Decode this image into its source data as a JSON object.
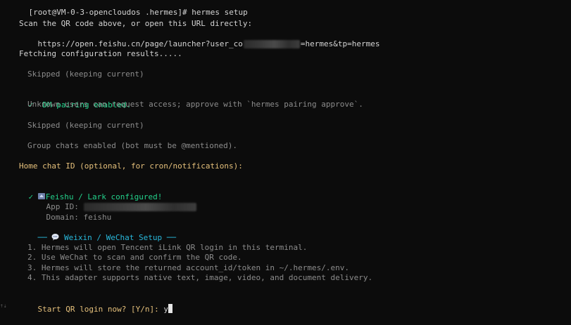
{
  "prompt": {
    "text": "[root@VM-0-3-opencloudos .hermes]# hermes setup"
  },
  "qr": {
    "scan_text": "Scan the QR code above, or open this URL directly:",
    "url_prefix": "https://open.feishu.cn/page/launcher?user_co",
    "url_suffix": "=hermes&tp=hermes"
  },
  "fetching": "Fetching configuration results.....",
  "skipped_1": "Skipped (keeping current)",
  "dm": {
    "check": "✓",
    "enabled": "DM pairing enabled.",
    "note": "Unknown users can request access; approve with `hermes pairing approve`."
  },
  "skipped_2": "Skipped (keeping current)",
  "group": "Group chats enabled (bot must be @mentioned).",
  "home_chat_prompt": "Home chat ID (optional, for cron/notifications):",
  "feishu": {
    "check": "✓",
    "configured": "Feishu / Lark configured!",
    "app_id_label": "App ID:",
    "domain_label": "Domain:",
    "domain_value": "feishu"
  },
  "weixin": {
    "header_left": "──",
    "header_title": "Weixin / WeChat Setup",
    "header_right": "──",
    "steps": [
      "1. Hermes will open Tencent iLink QR login in this terminal.",
      "2. Use WeChat to scan and confirm the QR code.",
      "3. Hermes will store the returned account_id/token in ~/.hermes/.env.",
      "4. This adapter supports native text, image, video, and document delivery."
    ]
  },
  "qr_prompt": {
    "text": "Start QR login now? [Y/n]:",
    "input_value": "y"
  },
  "icons": {
    "check": "check-icon",
    "feishu": "feishu-bird-icon",
    "chat": "speech-bubble-icon"
  },
  "colors": {
    "background": "#0c0c0c",
    "text": "#cccccc",
    "yellow": "#e5c07b",
    "green": "#23d18b",
    "cyan": "#29b8db"
  }
}
